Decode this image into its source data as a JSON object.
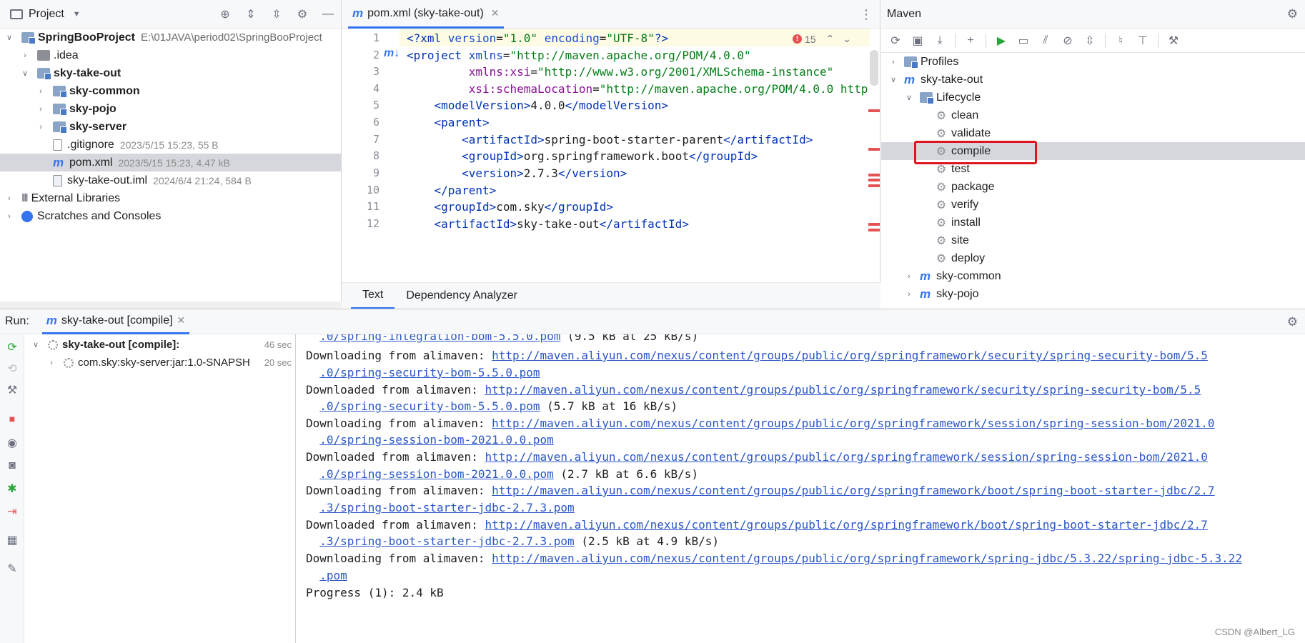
{
  "project": {
    "header_title": "Project",
    "tree": [
      {
        "label": "SpringBooProject",
        "meta": "E:\\01JAVA\\period02\\SpringBooProject"
      },
      {
        "label": ".idea"
      },
      {
        "label": "sky-take-out"
      },
      {
        "label": "sky-common"
      },
      {
        "label": "sky-pojo"
      },
      {
        "label": "sky-server"
      },
      {
        "label": ".gitignore",
        "meta": "2023/5/15 15:23, 55 B"
      },
      {
        "label": "pom.xml",
        "meta": "2023/5/15 15:23, 4.47 kB"
      },
      {
        "label": "sky-take-out.iml",
        "meta": "2024/6/4 21:24, 584 B"
      },
      {
        "label": "External Libraries"
      },
      {
        "label": "Scratches and Consoles"
      }
    ]
  },
  "editor": {
    "tab_label": "pom.xml (sky-take-out)",
    "error_count": "15",
    "bottom_tabs": [
      "Text",
      "Dependency Analyzer"
    ],
    "line_numbers": [
      "1",
      "2",
      "3",
      "4",
      "5",
      "6",
      "7",
      "8",
      "9",
      "10",
      "11",
      "12"
    ]
  },
  "maven": {
    "title": "Maven",
    "tree": [
      {
        "label": "Profiles"
      },
      {
        "label": "sky-take-out"
      },
      {
        "label": "Lifecycle"
      },
      {
        "label": "clean"
      },
      {
        "label": "validate"
      },
      {
        "label": "compile"
      },
      {
        "label": "test"
      },
      {
        "label": "package"
      },
      {
        "label": "verify"
      },
      {
        "label": "install"
      },
      {
        "label": "site"
      },
      {
        "label": "deploy"
      },
      {
        "label": "sky-common"
      },
      {
        "label": "sky-pojo"
      }
    ]
  },
  "run": {
    "label": "Run:",
    "tab_label": "sky-take-out [compile]",
    "tree": [
      {
        "label": "sky-take-out [compile]:",
        "time": "46 sec"
      },
      {
        "label": "com.sky:sky-server:jar:1.0-SNAPSH",
        "time": "20 sec"
      }
    ],
    "console": [
      {
        "prefix": "",
        "link": ".0/spring-integration-bom-5.5.0.pom",
        "suffix": " (9.5 kB at 25 kB/s)"
      },
      {
        "prefix": "Downloading from alimaven: ",
        "link": "http://maven.aliyun.com/nexus/content/groups/public/org/springframework/security/spring-security-bom/5.5",
        "suffix": ""
      },
      {
        "prefix": "",
        "link": ".0/spring-security-bom-5.5.0.pom",
        "suffix": ""
      },
      {
        "prefix": "Downloaded from alimaven: ",
        "link": "http://maven.aliyun.com/nexus/content/groups/public/org/springframework/security/spring-security-bom/5.5",
        "suffix": ""
      },
      {
        "prefix": "",
        "link": ".0/spring-security-bom-5.5.0.pom",
        "suffix": " (5.7 kB at 16 kB/s)"
      },
      {
        "prefix": "Downloading from alimaven: ",
        "link": "http://maven.aliyun.com/nexus/content/groups/public/org/springframework/session/spring-session-bom/2021.0",
        "suffix": ""
      },
      {
        "prefix": "",
        "link": ".0/spring-session-bom-2021.0.0.pom",
        "suffix": ""
      },
      {
        "prefix": "Downloaded from alimaven: ",
        "link": "http://maven.aliyun.com/nexus/content/groups/public/org/springframework/session/spring-session-bom/2021.0",
        "suffix": ""
      },
      {
        "prefix": "",
        "link": ".0/spring-session-bom-2021.0.0.pom",
        "suffix": " (2.7 kB at 6.6 kB/s)"
      },
      {
        "prefix": "Downloading from alimaven: ",
        "link": "http://maven.aliyun.com/nexus/content/groups/public/org/springframework/boot/spring-boot-starter-jdbc/2.7",
        "suffix": ""
      },
      {
        "prefix": "",
        "link": ".3/spring-boot-starter-jdbc-2.7.3.pom",
        "suffix": ""
      },
      {
        "prefix": "Downloaded from alimaven: ",
        "link": "http://maven.aliyun.com/nexus/content/groups/public/org/springframework/boot/spring-boot-starter-jdbc/2.7",
        "suffix": ""
      },
      {
        "prefix": "",
        "link": ".3/spring-boot-starter-jdbc-2.7.3.pom",
        "suffix": " (2.5 kB at 4.9 kB/s)"
      },
      {
        "prefix": "Downloading from alimaven: ",
        "link": "http://maven.aliyun.com/nexus/content/groups/public/org/springframework/spring-jdbc/5.3.22/spring-jdbc-5.3.22",
        "suffix": ""
      },
      {
        "prefix": "",
        "link": ".pom",
        "suffix": ""
      },
      {
        "prefix": "Progress (1): 2.4 kB",
        "link": "",
        "suffix": ""
      }
    ],
    "watermark": "CSDN @Albert_LG"
  }
}
